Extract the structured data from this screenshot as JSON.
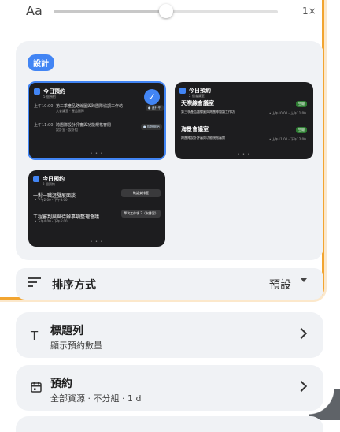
{
  "font_size": {
    "label": "Aa",
    "zoom": "1×",
    "level_fraction": 0.5
  },
  "group": {
    "chip": "設計"
  },
  "thumbs": {
    "one": {
      "title": "今日預約",
      "subtitle": "5 個預約",
      "row1_time": "上午10:00",
      "row1_text": "第三季產品路線圖與跨團隊協調工作坊",
      "row1_meta": "大會議室 · 產品團隊",
      "row2_time": "上午11:00",
      "row2_text": "跨團隊設計評審與功能規格審閱",
      "row2_meta": "設計室 · 設計組",
      "row1_tag": "● 進行中",
      "row2_tag": "● 即將開始",
      "dots": "• • •"
    },
    "two": {
      "title": "今日預約",
      "subtitle": "2 個會議室",
      "room1": "天際線會議室",
      "room1_state": "空閒",
      "room1_text": "第三季產品路線圖與跨團隊協調工作坊",
      "room1_meta": "• 上午10:00 - 上午11:00",
      "room2": "海景會議室",
      "room2_state": "空閒",
      "room2_text": "跨團隊設計評審與功能規格審閱",
      "room2_meta": "• 上午11:00 - 下午12:00",
      "dots": "• • •"
    },
    "three": {
      "title": "今日預約",
      "subtitle": "2 個預約",
      "row1_text": "一對一職涯發展面談",
      "row1_meta": "• 下午2:00 - 下午3:00",
      "row2_text": "工程審判與與待辦事項整理會議",
      "row2_meta": "• 下午4:00 - 下午5:00",
      "btn1": "確認安排室",
      "btn2": "單次工作項 3（安排室）",
      "dots": "• • •"
    }
  },
  "sort": {
    "label": "排序方式",
    "value": "預設"
  },
  "menu": [
    {
      "title": "標題列",
      "subtitle": "顯示預約數量"
    },
    {
      "title": "預約",
      "subtitle": "全部資源 · 不分組 · 1 d"
    }
  ]
}
